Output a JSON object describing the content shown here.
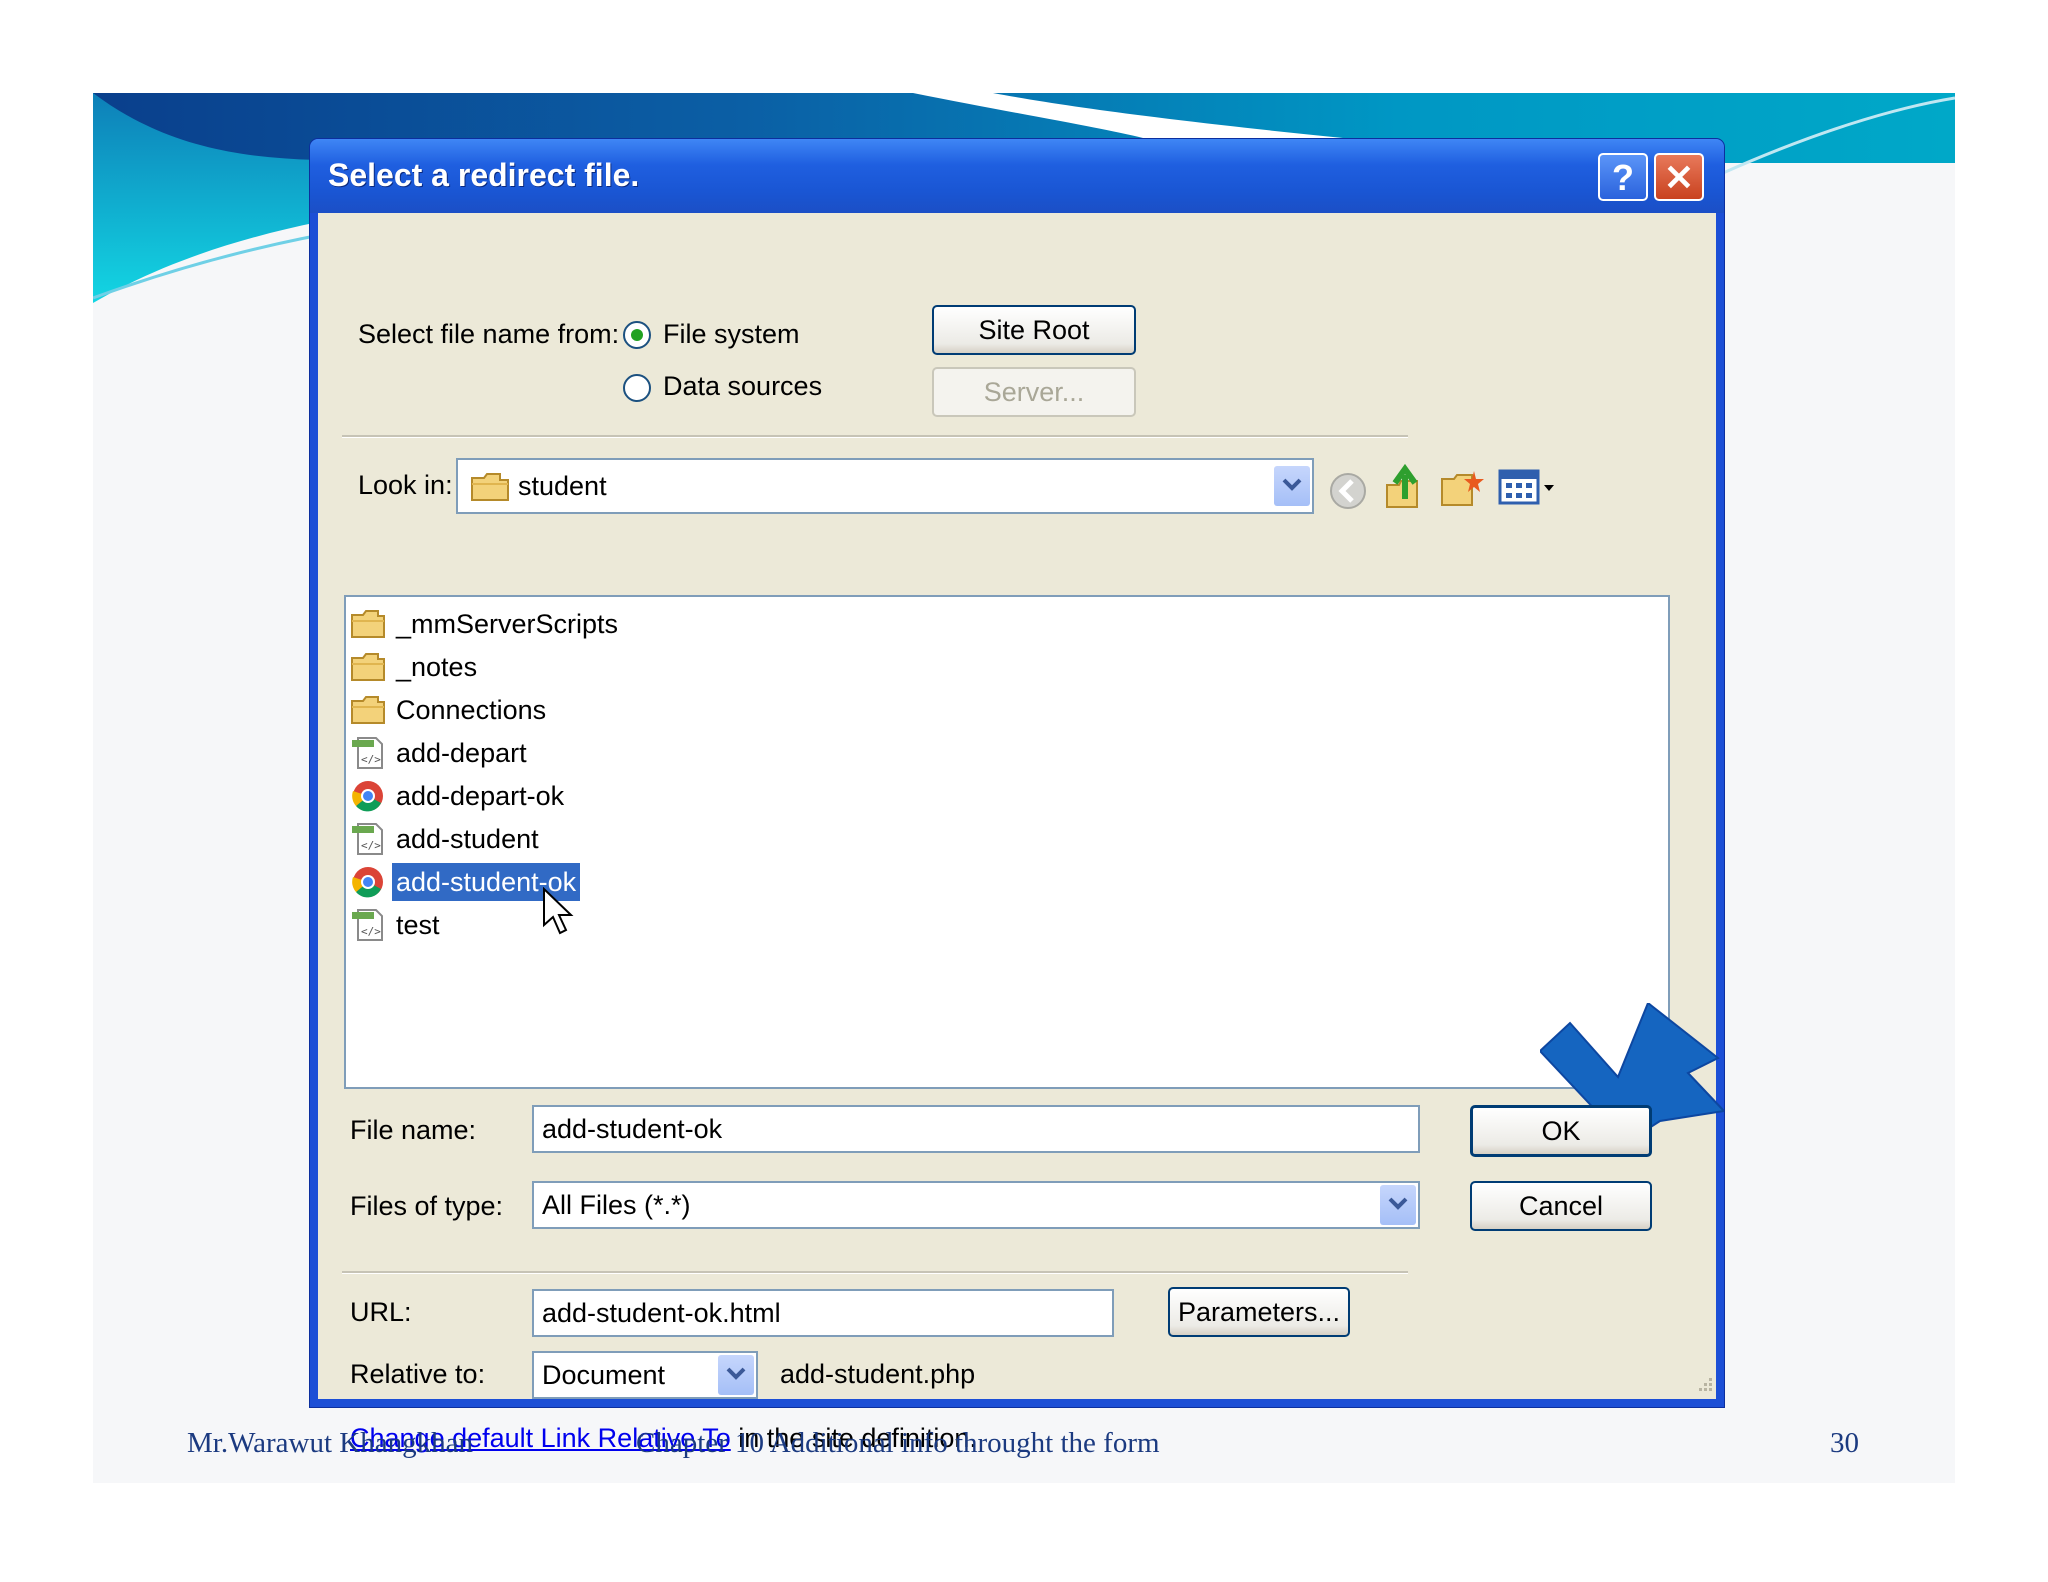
{
  "dialog": {
    "title": "Select a redirect file.",
    "help_glyph": "?",
    "close_glyph": "✕",
    "select_from_label": "Select file name from:",
    "radio_filesystem": "File system",
    "radio_datasources": "Data sources",
    "selected_source": "File system",
    "site_root_button": "Site Root",
    "server_button": "Server...",
    "look_in_label": "Look in:",
    "look_in_value": "student",
    "files": [
      {
        "name": "_mmServerScripts",
        "icon": "folder-icon"
      },
      {
        "name": "_notes",
        "icon": "folder-icon"
      },
      {
        "name": "Connections",
        "icon": "folder-icon"
      },
      {
        "name": "add-depart",
        "icon": "php-file-icon"
      },
      {
        "name": "add-depart-ok",
        "icon": "chrome-html-file-icon"
      },
      {
        "name": "add-student",
        "icon": "php-file-icon"
      },
      {
        "name": "add-student-ok",
        "icon": "chrome-html-file-icon",
        "selected": true
      },
      {
        "name": "test",
        "icon": "php-file-icon"
      }
    ],
    "file_name_label": "File name:",
    "file_name_value": "add-student-ok",
    "files_of_type_label": "Files of type:",
    "files_of_type_value": "All Files (*.*)",
    "ok_button": "OK",
    "cancel_button": "Cancel",
    "url_label": "URL:",
    "url_value": "add-student-ok.html",
    "parameters_button": "Parameters...",
    "relative_to_label": "Relative to:",
    "relative_to_value": "Document",
    "relative_file": "add-student.php",
    "change_link_text": "Change default Link Relative To",
    "change_suffix": " in the site definition."
  },
  "footer": {
    "author": "Mr.Warawut  Khangkhan",
    "chapter": "Chapter 10 Additional info throught the form",
    "page_number": "30"
  },
  "colors": {
    "titlebar": "#1f5fe0",
    "dialog_face": "#ece9d8",
    "selection": "#316ac5",
    "annotation_arrow": "#1565c0",
    "slide_header_teal": "#00a8c8"
  }
}
